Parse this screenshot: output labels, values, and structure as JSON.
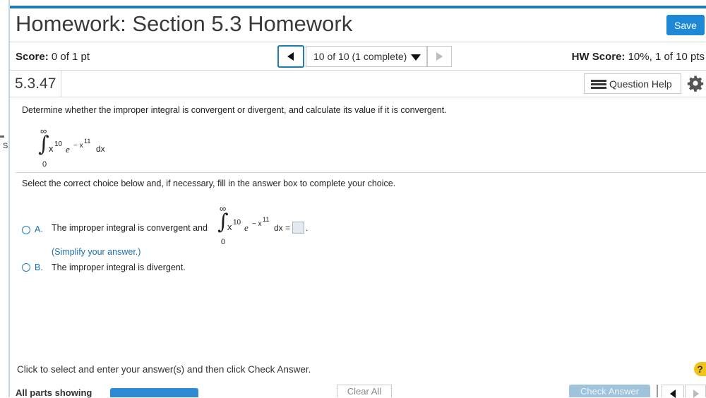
{
  "header": {
    "title": "Homework: Section 5.3 Homework",
    "save_label": "Save"
  },
  "left_strip": {
    "letter": "S"
  },
  "score_bar": {
    "score_label": "Score:",
    "score_value": "0 of 1 pt",
    "question_selector": "10 of 10 (1 complete)",
    "hw_score_label": "HW Score:",
    "hw_score_value": "10%, 1 of 10 pts"
  },
  "question": {
    "number": "5.3.47",
    "help_label": "Question Help",
    "prompt": "Determine whether the improper integral is convergent or divergent, and calculate its value if it is convergent.",
    "integral": {
      "upper": "∞",
      "lower": "0",
      "sign": "∫",
      "base": "x",
      "power": "10",
      "e": "e",
      "e_power": "− x",
      "e_power_power": "11",
      "dx": "dx"
    },
    "instruction": "Select the correct choice below and, if necessary, fill in the answer box to complete your choice.",
    "options": [
      {
        "letter": "A.",
        "text": "The improper integral is convergent and",
        "equals": "dx =",
        "period": ".",
        "hint": "(Simplify your answer.)"
      },
      {
        "letter": "B.",
        "text": "The improper integral is divergent."
      }
    ]
  },
  "footer": {
    "message": "Click to select and enter your answer(s) and then click Check Answer.",
    "help_glyph": "?",
    "all_parts": "All parts showing",
    "clear_all": "Clear All",
    "check_answer": "Check Answer"
  },
  "colors": {
    "accent": "#1e7bb8",
    "save_button": "#1e88d4",
    "link_text": "#1e6fa8",
    "check_answer_disabled": "#9fc3dd",
    "help_badge": "#f0c419"
  },
  "icons": {
    "prev": "chevron-left-icon",
    "next": "chevron-right-icon",
    "dropdown": "caret-down-icon",
    "help": "list-icon",
    "settings": "gear-icon"
  }
}
